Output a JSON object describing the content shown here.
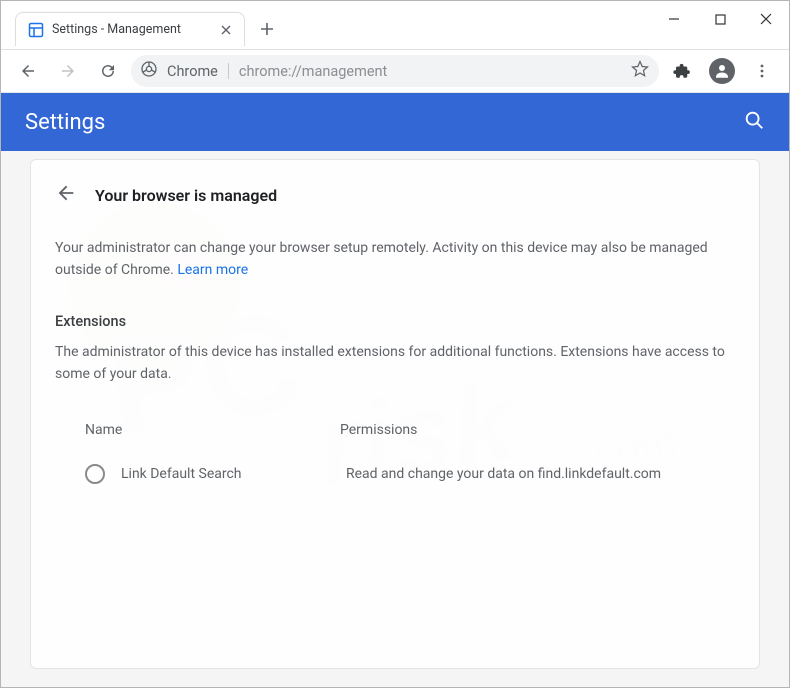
{
  "titlebar": {
    "tab_title": "Settings - Management"
  },
  "addrbar": {
    "scheme_label": "Chrome",
    "url": "chrome://management"
  },
  "settings": {
    "app_title": "Settings",
    "page_title": "Your browser is managed",
    "intro_text": "Your administrator can change your browser setup remotely. Activity on this device may also be managed outside of Chrome. ",
    "learn_more": "Learn more",
    "extensions_heading": "Extensions",
    "extensions_text": "The administrator of this device has installed extensions for additional functions. Extensions have access to some of your data.",
    "table": {
      "name_header": "Name",
      "permissions_header": "Permissions",
      "rows": [
        {
          "name": "Link Default Search",
          "permissions": "Read and change your data on find.linkdefault.com"
        }
      ]
    }
  }
}
